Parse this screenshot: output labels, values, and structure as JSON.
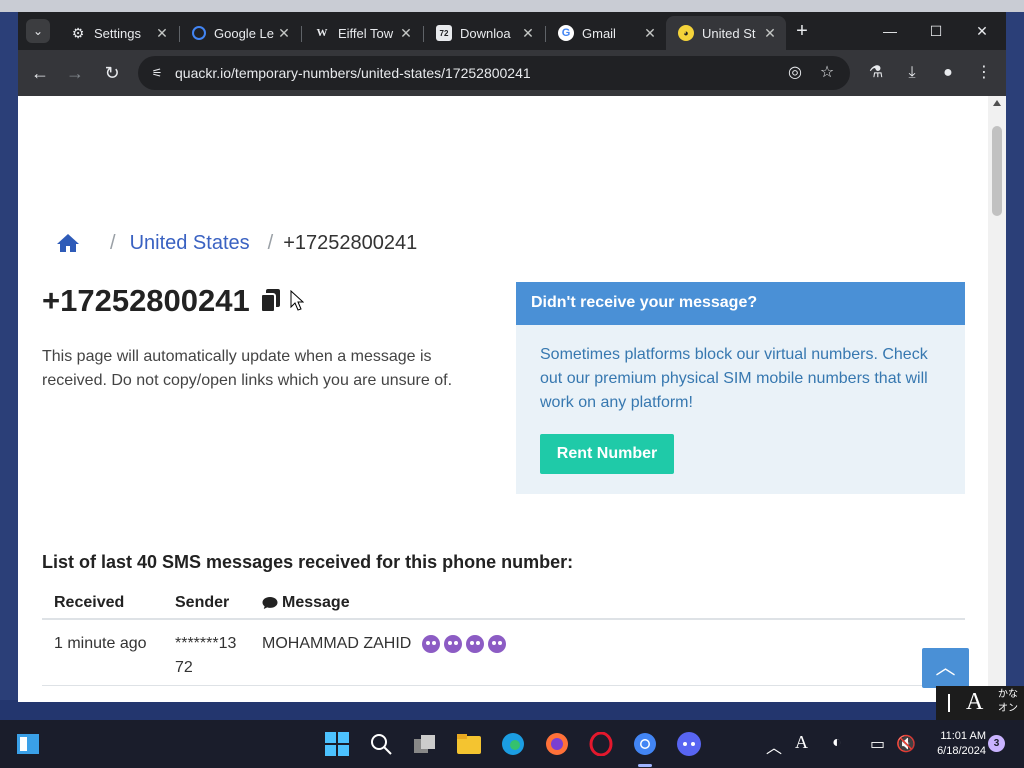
{
  "browser": {
    "tabs": [
      {
        "label": "Settings",
        "icon": "gear-icon",
        "active": false
      },
      {
        "label": "Google Le",
        "icon": "google-lens-icon",
        "active": false
      },
      {
        "label": "Eiffel Tow",
        "icon": "wiki-icon",
        "active": false
      },
      {
        "label": "Downloa",
        "icon": "download-site-icon",
        "active": false
      },
      {
        "label": "Gmail",
        "icon": "google-icon",
        "active": false
      },
      {
        "label": "United St",
        "icon": "quackr-icon",
        "active": true
      }
    ],
    "url": "quackr.io/temporary-numbers/united-states/17252800241"
  },
  "page": {
    "breadcrumb": {
      "country": "United States",
      "current": "+17252800241"
    },
    "phone_number": "+17252800241",
    "intro": "This page will automatically update when a message is received. Do not copy/open links which you are unsure of.",
    "card": {
      "title": "Didn't receive your message?",
      "body": "Sometimes platforms block our virtual numbers. Check out our premium physical SIM mobile numbers that will work on any platform!",
      "button": "Rent Number"
    },
    "list_heading": "List of last 40 SMS messages received for this phone number:",
    "table": {
      "headers": {
        "received": "Received",
        "sender": "Sender",
        "message": "Message"
      },
      "rows": [
        {
          "received": "1 minute ago",
          "sender": "*******1372",
          "message": "MOHAMMAD ZAHID"
        }
      ]
    }
  },
  "ime": {
    "mode": "A",
    "kana": "かな\nオン"
  },
  "taskbar": {
    "time": "11:01 AM",
    "date": "6/18/2024",
    "notifications": "3"
  },
  "colors": {
    "card_header": "#4a90d6",
    "rent_button": "#1fcaa8",
    "link": "#3a62c2"
  }
}
